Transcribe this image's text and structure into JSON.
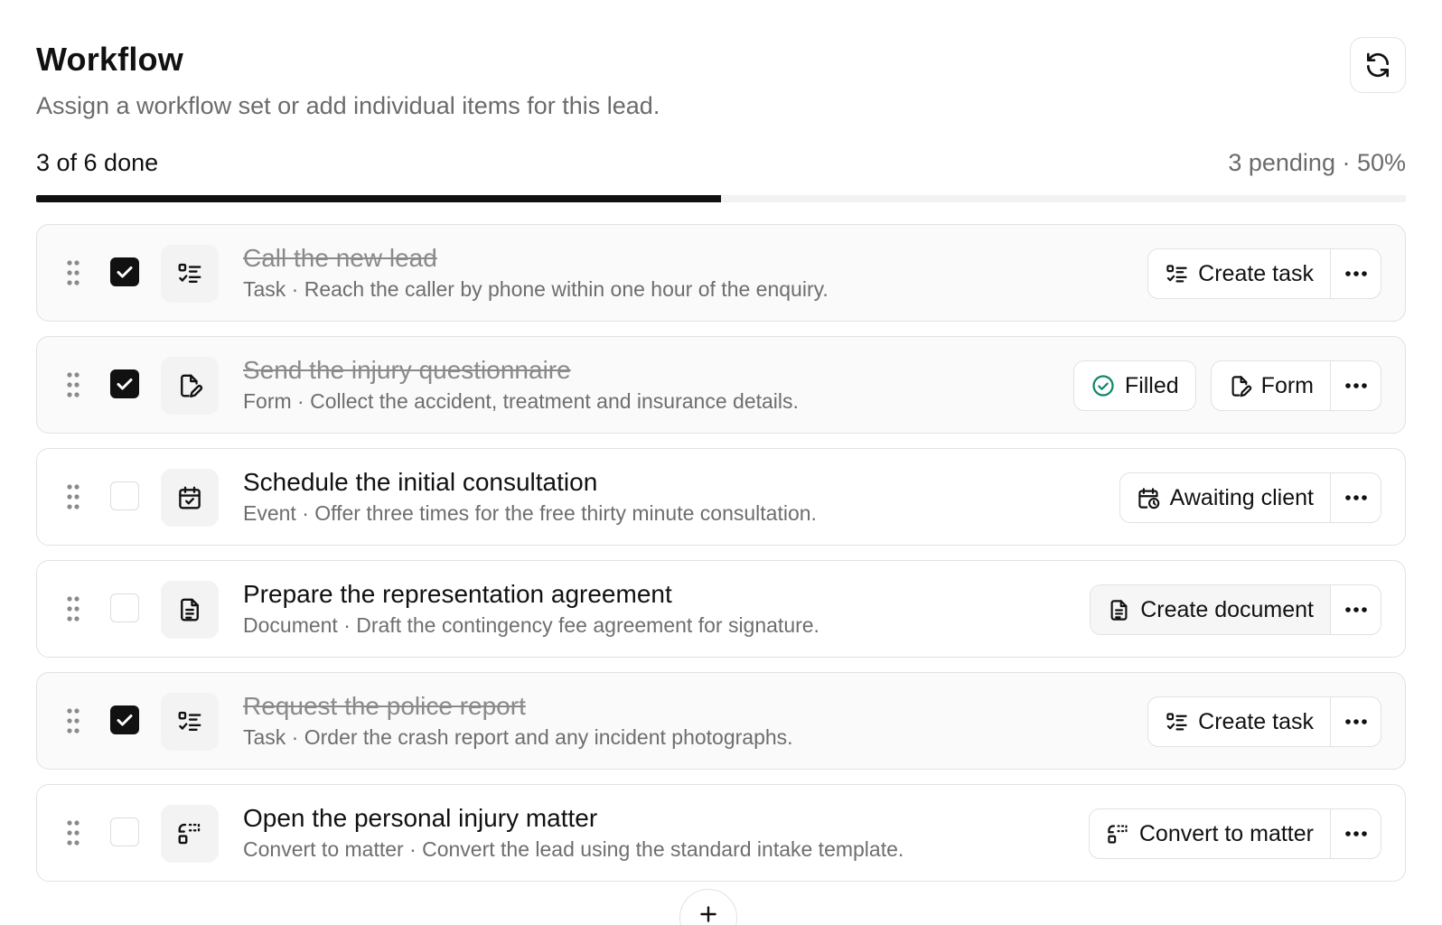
{
  "header": {
    "title": "Workflow",
    "subtitle": "Assign a workflow set or add individual items for this lead.",
    "refresh_icon": "refresh-icon"
  },
  "progress": {
    "done_text": "3 of 6 done",
    "pending_text": "3 pending · 50%",
    "fraction": 0.5
  },
  "items": [
    {
      "title": "Call the new lead",
      "description": "Task · Reach the caller by phone within one hour of the enquiry.",
      "checked": true,
      "type_icon": "task-list-icon",
      "status": null,
      "action_label": "Create task",
      "action_icon": "task-list-icon"
    },
    {
      "title": "Send the injury questionnaire",
      "description": "Form · Collect the accident, treatment and insurance details.",
      "checked": true,
      "type_icon": "form-edit-icon",
      "status": "Filled",
      "status_icon": "check-circle-icon",
      "action_label": "Form",
      "action_icon": "form-edit-icon"
    },
    {
      "title": "Schedule the initial consultation",
      "description": "Event · Offer three times for the free thirty minute consultation.",
      "checked": false,
      "type_icon": "calendar-check-icon",
      "status": null,
      "action_label": "Awaiting client",
      "action_icon": "calendar-clock-icon"
    },
    {
      "title": "Prepare the representation agreement",
      "description": "Document · Draft the contingency fee agreement for signature.",
      "checked": false,
      "type_icon": "document-icon",
      "status": null,
      "action_label": "Create document",
      "action_icon": "document-icon"
    },
    {
      "title": "Request the police report",
      "description": "Task · Order the crash report and any incident photographs.",
      "checked": true,
      "type_icon": "task-list-icon",
      "status": null,
      "action_label": "Create task",
      "action_icon": "task-list-icon"
    },
    {
      "title": "Open the personal injury matter",
      "description": "Convert to matter · Convert the lead using the standard intake template.",
      "checked": false,
      "type_icon": "convert-icon",
      "status": null,
      "action_label": "Convert to matter",
      "action_icon": "convert-icon"
    }
  ],
  "colors": {
    "accent": "#111111",
    "success": "#10866a",
    "muted_text": "#6b6b6b",
    "border": "#e2e2e2"
  }
}
